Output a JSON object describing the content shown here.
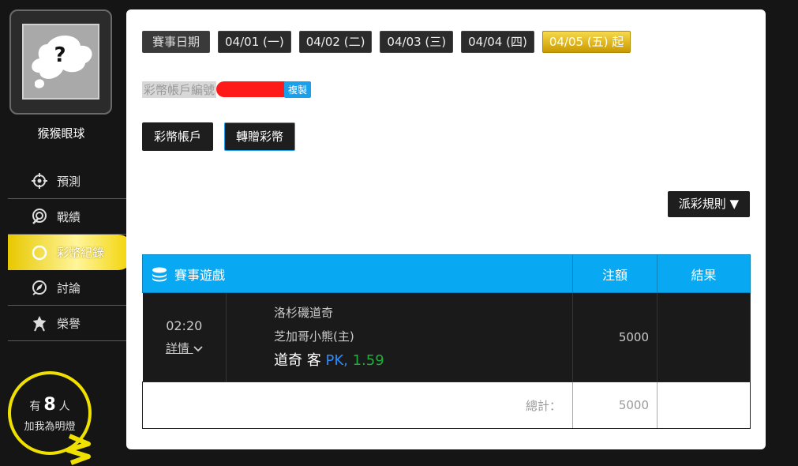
{
  "sidebar": {
    "avatar_glyph": "?",
    "username": "猴猴眼球",
    "nav": [
      {
        "label": "預測",
        "icon": "crosshair-icon"
      },
      {
        "label": "戰績",
        "icon": "target-icon"
      },
      {
        "label": "彩幣紀錄",
        "icon": "coin-icon",
        "active": true
      },
      {
        "label": "討論",
        "icon": "chat-edit-icon"
      },
      {
        "label": "榮譽",
        "icon": "medal-icon"
      }
    ],
    "fans": {
      "prefix": "有",
      "count": "8",
      "suffix": "人",
      "line2": "加我為明燈"
    }
  },
  "date_tabs": {
    "label": "賽事日期",
    "items": [
      "04/01 (一)",
      "04/02 (二)",
      "04/03 (三)",
      "04/04 (四)",
      "04/05 (五) 起"
    ],
    "active_index": 4
  },
  "account": {
    "label": "彩幣帳戶編號",
    "copy_label": "複製"
  },
  "account_buttons": {
    "wallet": "彩幣帳戶",
    "transfer": "轉贈彩幣"
  },
  "rules_button": "派彩規則 ▼",
  "table": {
    "headers": {
      "game": "賽事遊戲",
      "amount": "注額",
      "result": "結果"
    },
    "rows": [
      {
        "time": "02:20",
        "detail": "詳情",
        "away": "洛杉磯道奇",
        "home": "芝加哥小熊(主)",
        "pick_team": "道奇 客",
        "pick_type": "PK,",
        "pick_odds": "1.59",
        "amount": "5000",
        "result": ""
      }
    ],
    "total_label": "總計：",
    "total_value": "5000"
  },
  "colors": {
    "accent": "#08a8f2",
    "active_gold": "#e8c800",
    "redaction": "#ff1a1a"
  }
}
